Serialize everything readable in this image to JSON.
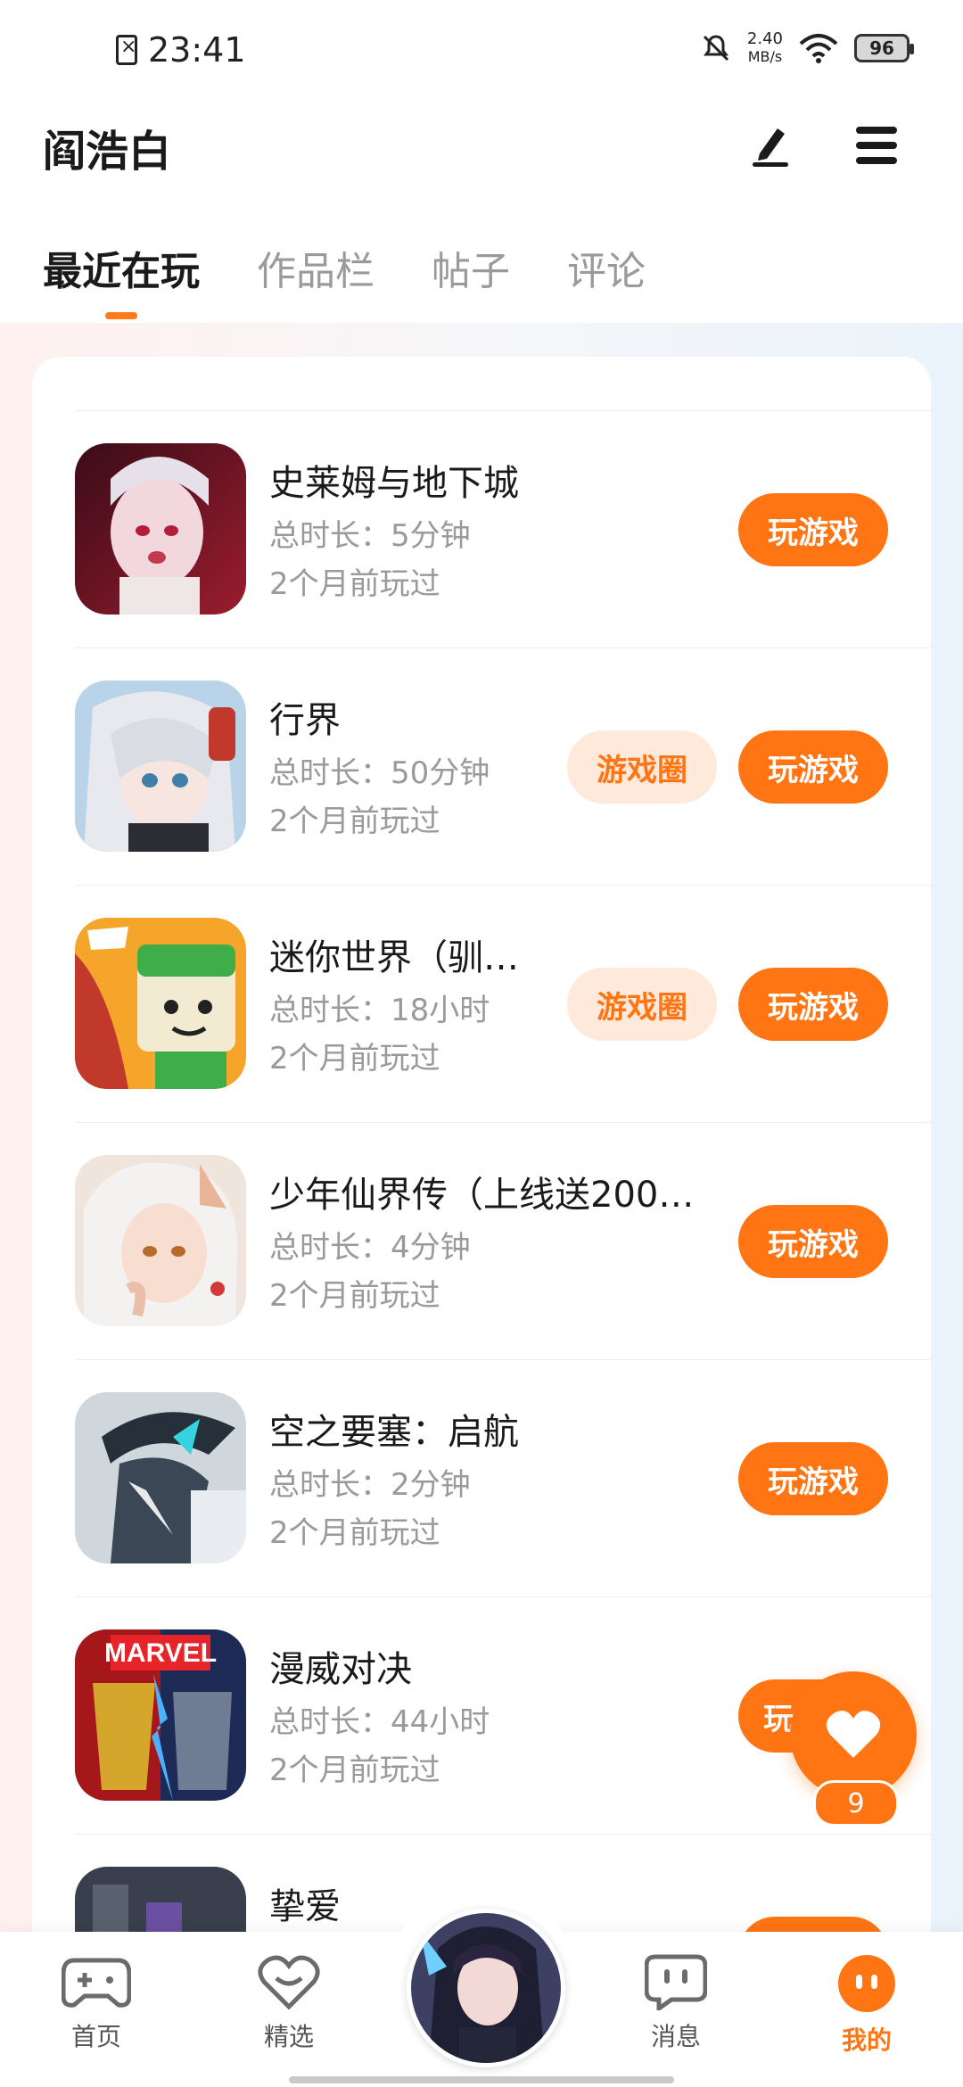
{
  "status_bar": {
    "time": "23:41",
    "net_speed_value": "2.40",
    "net_speed_unit": "MB/s",
    "battery": "96"
  },
  "header": {
    "title": "阎浩白"
  },
  "tabs": [
    {
      "label": "最近在玩",
      "active": true
    },
    {
      "label": "作品栏",
      "active": false
    },
    {
      "label": "帖子",
      "active": false
    },
    {
      "label": "评论",
      "active": false
    }
  ],
  "games": [
    {
      "title": "史莱姆与地下城",
      "duration": "总时长：5分钟",
      "last_played": "2个月前玩过",
      "play_label": "玩游戏"
    },
    {
      "title": "行界",
      "duration": "总时长：50分钟",
      "last_played": "2个月前玩过",
      "play_label": "玩游戏",
      "circle_label": "游戏圈"
    },
    {
      "title": "迷你世界（驯…",
      "duration": "总时长：18小时",
      "last_played": "2个月前玩过",
      "play_label": "玩游戏",
      "circle_label": "游戏圈"
    },
    {
      "title": "少年仙界传（上线送200…",
      "duration": "总时长：4分钟",
      "last_played": "2个月前玩过",
      "play_label": "玩游戏"
    },
    {
      "title": "空之要塞：启航",
      "duration": "总时长：2分钟",
      "last_played": "2个月前玩过",
      "play_label": "玩游戏"
    },
    {
      "title": "漫威对决",
      "duration": "总时长：44小时",
      "last_played": "2个月前玩过",
      "play_label": "玩"
    },
    {
      "title": "挚爱",
      "duration": "",
      "last_played": "",
      "play_label": ""
    }
  ],
  "fab": {
    "count": "9"
  },
  "bottom_nav": [
    {
      "label": "首页",
      "icon": "gamepad-icon"
    },
    {
      "label": "精选",
      "icon": "heart-chat-icon"
    },
    {
      "label": "",
      "icon": "avatar"
    },
    {
      "label": "消息",
      "icon": "message-icon"
    },
    {
      "label": "我的",
      "icon": "profile-face-icon",
      "active": true
    }
  ],
  "colors": {
    "accent": "#ff7513",
    "accent_light": "#ffe9db"
  }
}
